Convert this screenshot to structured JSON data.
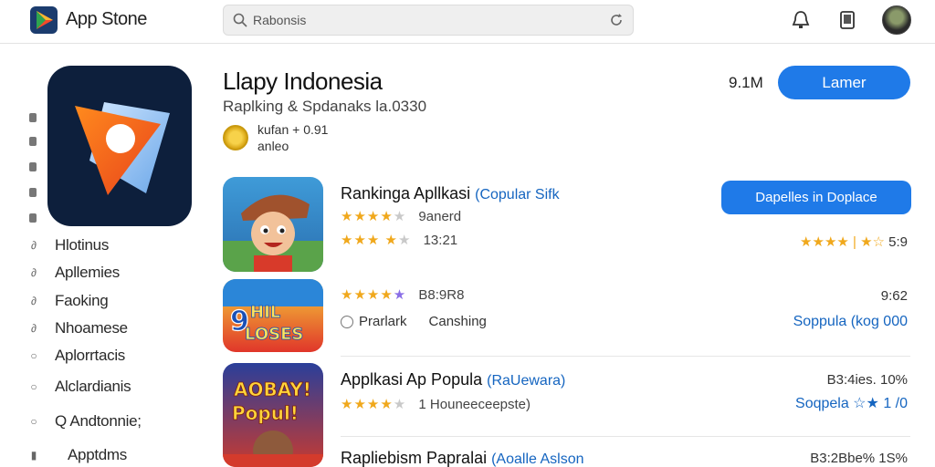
{
  "header": {
    "app_name": "App Stone",
    "search_placeholder": "Rabonsis",
    "icons": [
      "app-store-logo-icon",
      "search-icon",
      "refresh-icon",
      "notification-bell-icon",
      "device-icon",
      "avatar"
    ]
  },
  "sidebar": {
    "items": [
      {
        "icon": "person-icon",
        "label": "Hlotinus"
      },
      {
        "icon": "d-icon",
        "label": "Apllemies"
      },
      {
        "icon": "d-icon",
        "label": "Faoking"
      },
      {
        "icon": "d-icon",
        "label": "Nhoamese"
      },
      {
        "icon": "circle-icon",
        "label": "Aplorrtacis"
      },
      {
        "icon": "circle-icon",
        "label": "Alclardianis"
      },
      {
        "icon": "circle-icon",
        "label": "Q Andtonnie;"
      },
      {
        "icon": "bag-icon",
        "label": "Apptdms"
      }
    ]
  },
  "hero": {
    "title": "Llapy Indonesia",
    "subtitle": "Raplking & Spdanaks la.0330",
    "badge_line1": "kufan  + 0.91",
    "badge_line2": "anleo",
    "size": "9.1M",
    "button_label": "Lamer"
  },
  "rows": [
    {
      "title": "Rankinga Apllkasi",
      "title_accent": "(Copular Sifk",
      "stars1": 4,
      "meta1": "9anerd",
      "stars2": 3.5,
      "meta2": "13:21",
      "button_label": "Dapelles in Doplace",
      "right_rating_stars": "★★★★  |  ★☆",
      "right_rating_value": "5:9"
    },
    {
      "thumb_text": "9HIL LOSES",
      "stars": 5,
      "meta": "B8:9R8",
      "pill_label1": "Prarlark",
      "pill_label2": "Canshing",
      "right_text": "9:62",
      "right_link": "Soppula (kog 000"
    },
    {
      "thumb_text": "AOBAY! Popul!",
      "title": "Applkasi Ap Popula",
      "title_accent": "(RaUewara)",
      "stars": 4,
      "meta": "1 Houneeceepste)",
      "right_text": "B3:4ies. 10%",
      "right_link": "Soqpela ☆★ 1 /0"
    },
    {
      "title": "Rapliebism Papralai",
      "title_accent": "(Aoalle Aslson",
      "right_text": "B3:2Bbe% 1S%"
    }
  ],
  "colors": {
    "accent": "#1f7ae8",
    "link": "#1565c0",
    "star": "#f0a81c"
  }
}
